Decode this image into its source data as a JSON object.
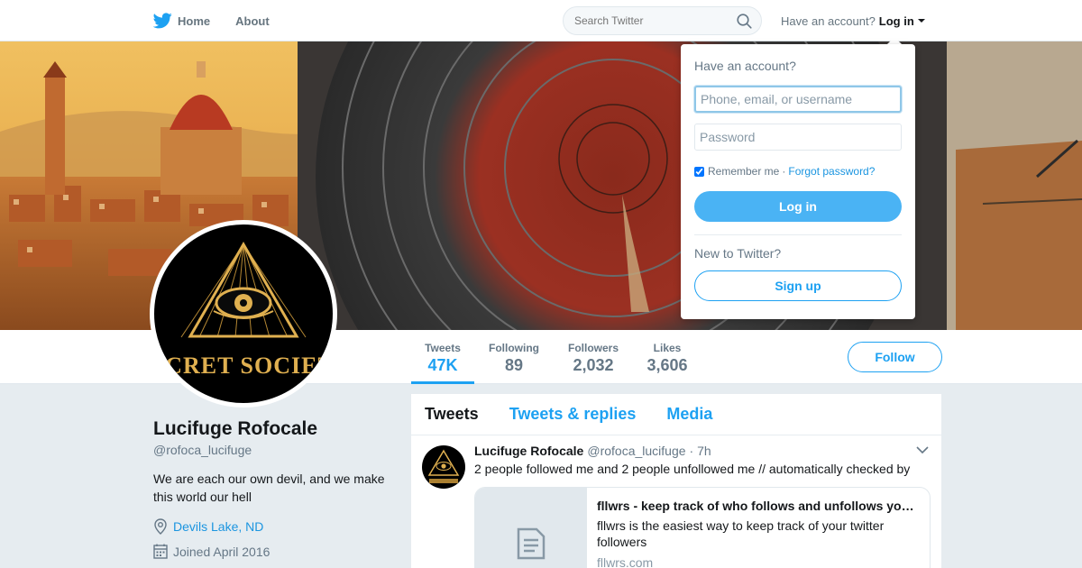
{
  "nav": {
    "home_label": "Home",
    "about_label": "About",
    "search_placeholder": "Search Twitter",
    "have_account_text": "Have an account?",
    "login_label": "Log in",
    "brand_icon": "twitter-bird-icon"
  },
  "banner": {
    "seal_text": "SECRET SOCIETY"
  },
  "profile": {
    "name": "Lucifuge Rofocale",
    "handle": "@rofoca_lucifuge",
    "bio": "We are each our own devil, and we make this world our hell",
    "location": "Devils Lake, ND",
    "joined": "Joined April 2016",
    "avatar_text": "SECRET SOCIETY"
  },
  "stats": [
    {
      "label": "Tweets",
      "value": "47K"
    },
    {
      "label": "Following",
      "value": "89"
    },
    {
      "label": "Followers",
      "value": "2,032"
    },
    {
      "label": "Likes",
      "value": "3,606"
    }
  ],
  "follow_label": "Follow",
  "timeline": {
    "tabs": [
      "Tweets",
      "Tweets & replies",
      "Media"
    ],
    "tweet": {
      "name": "Lucifuge Rofocale",
      "handle": "@rofoca_lucifuge",
      "time": "· 7h",
      "text": "2 people followed me and 2 people unfollowed me // automatically checked by",
      "card": {
        "title": "fllwrs - keep track of who follows and unfollows you on twitter",
        "description": "fllwrs is the easiest way to keep track of your twitter followers",
        "domain": "fllwrs.com"
      }
    }
  },
  "login_dropdown": {
    "heading": "Have an account?",
    "username_placeholder": "Phone, email, or username",
    "password_placeholder": "Password",
    "remember_label": "Remember me",
    "separator": "·",
    "forgot_label": "Forgot password?",
    "login_button": "Log in",
    "new_text": "New to Twitter?",
    "signup_button": "Sign up"
  },
  "colors": {
    "accent": "#1da1f2",
    "login_button_bg": "#4ab3f4",
    "page_bg": "#e6ecf0"
  }
}
